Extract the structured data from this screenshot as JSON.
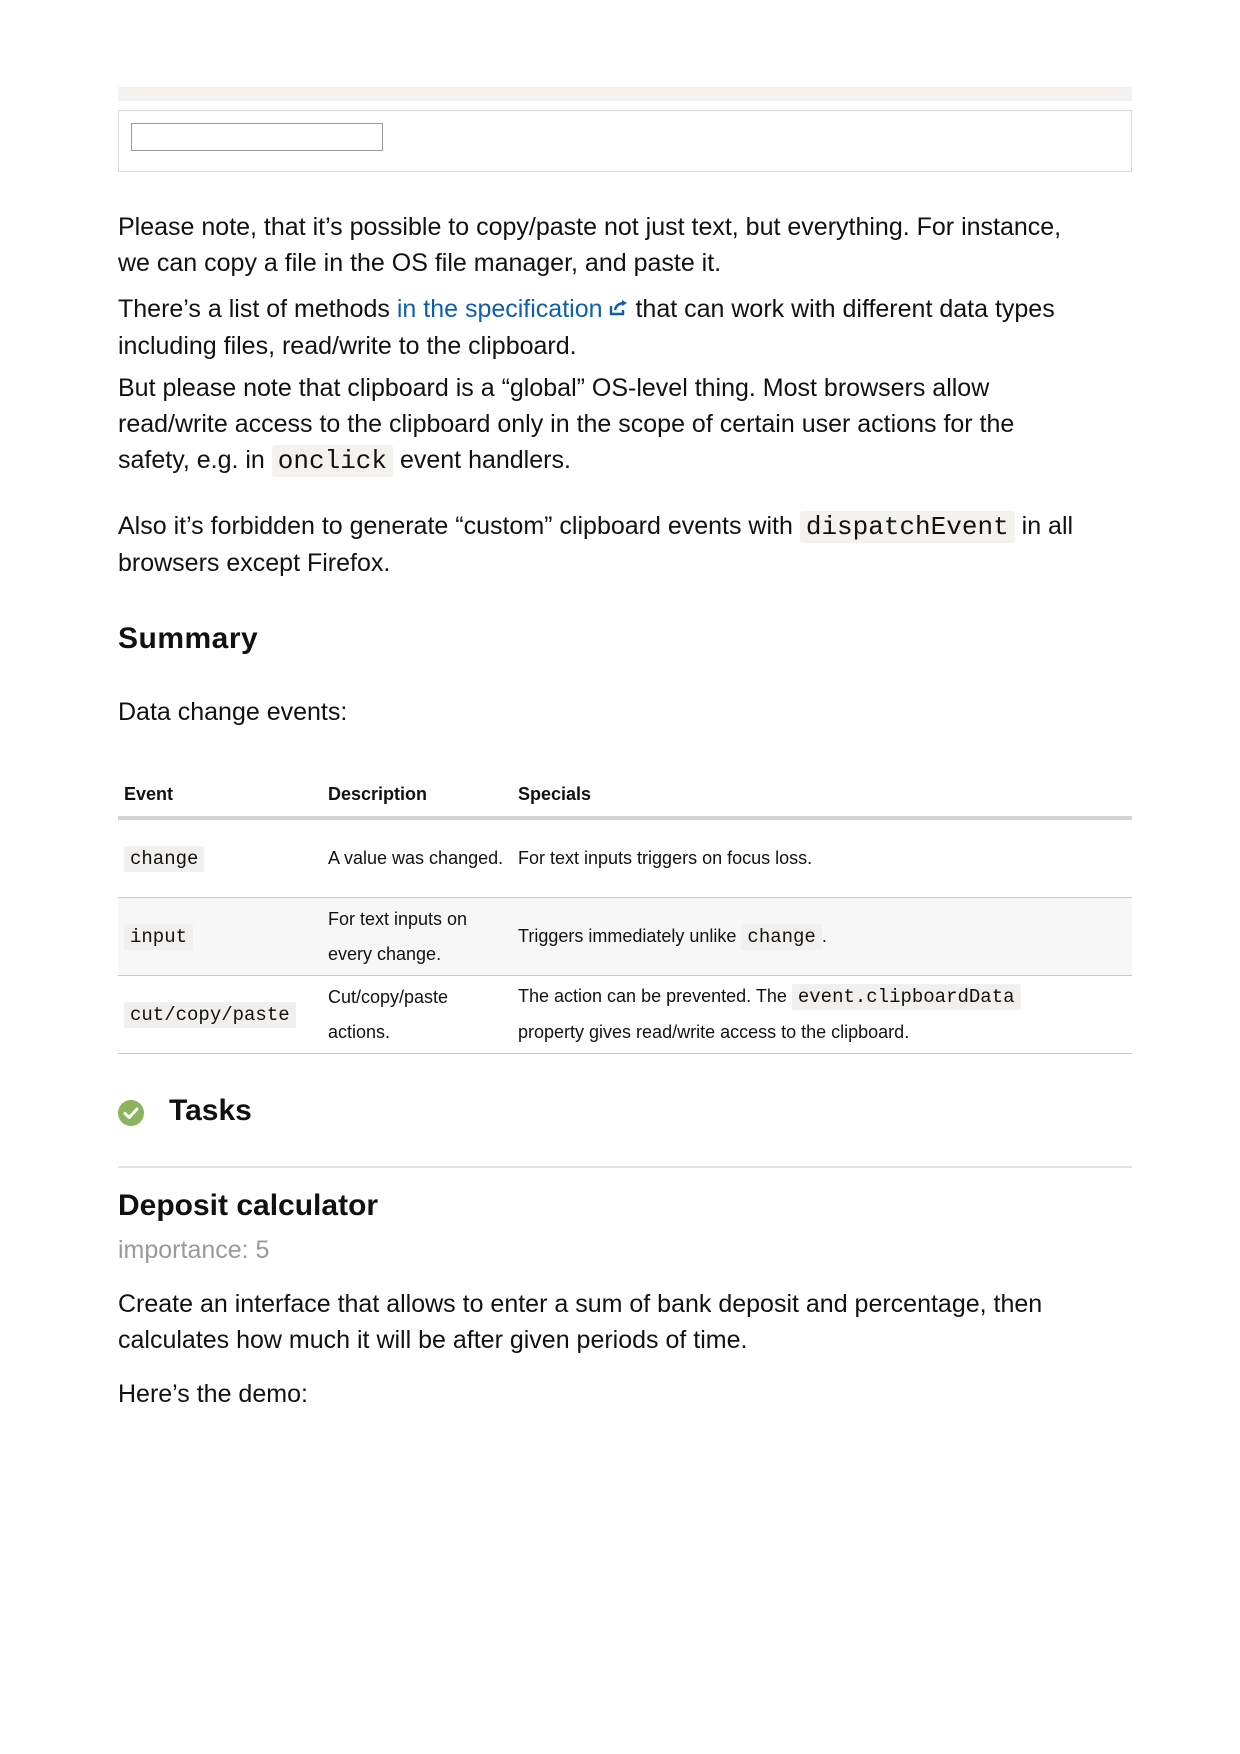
{
  "demo": {
    "input_value": ""
  },
  "p1": {
    "line1": "Please note, that it’s possible to copy/paste not just text, but everything. For instance,",
    "line2": "we can copy a file in the OS file manager, and paste it."
  },
  "p2": {
    "prefix": "There’s a list of methods ",
    "link": "in the specification",
    "suffix": " that can work with different data types",
    "line2": "including files, read/write to the clipboard.",
    "link_icon": "external-link-icon",
    "link_color": "#0f5fa6"
  },
  "p3": {
    "line1": "But please note that clipboard is a “global” OS-level thing. Most browsers allow",
    "line2": "read/write access to the clipboard only in the scope of certain user actions for the",
    "line3_prefix": "safety, e.g. in ",
    "line3_code": "onclick",
    "line3_suffix": " event handlers."
  },
  "p4": {
    "line1_prefix": "Also it’s forbidden to generate “custom” clipboard events with ",
    "line1_code": "dispatchEvent",
    "line1_suffix": " in all",
    "line2": "browsers except Firefox."
  },
  "summary": {
    "heading": "Summary",
    "intro": "Data change events:"
  },
  "table": {
    "headers": [
      "Event",
      "Description",
      "Specials"
    ],
    "rows": [
      {
        "event": "change",
        "desc": "A value was changed.",
        "specials": "For text inputs triggers on focus loss."
      },
      {
        "event": "input",
        "desc": "For text inputs on every change.",
        "specials_prefix": "Triggers immediately unlike ",
        "specials_code": "change",
        "specials_suffix": "."
      },
      {
        "event": "cut/copy/paste",
        "desc": "Cut/copy/paste actions.",
        "specials_prefix": "The action can be prevented. The ",
        "specials_code": "event.clipboardData",
        "specials_suffix": "property gives read/write access to the clipboard."
      }
    ]
  },
  "tasks": {
    "heading": "Tasks",
    "icon": "check-circle-icon",
    "icon_color": "#8ab55c",
    "title": "Deposit calculator",
    "importance": "importance: 5",
    "desc_line1": "Create an interface that allows to enter a sum of bank deposit and percentage, then",
    "desc_line2": "calculates how much it will be after given periods of time.",
    "demo_label": "Here’s the demo:"
  }
}
